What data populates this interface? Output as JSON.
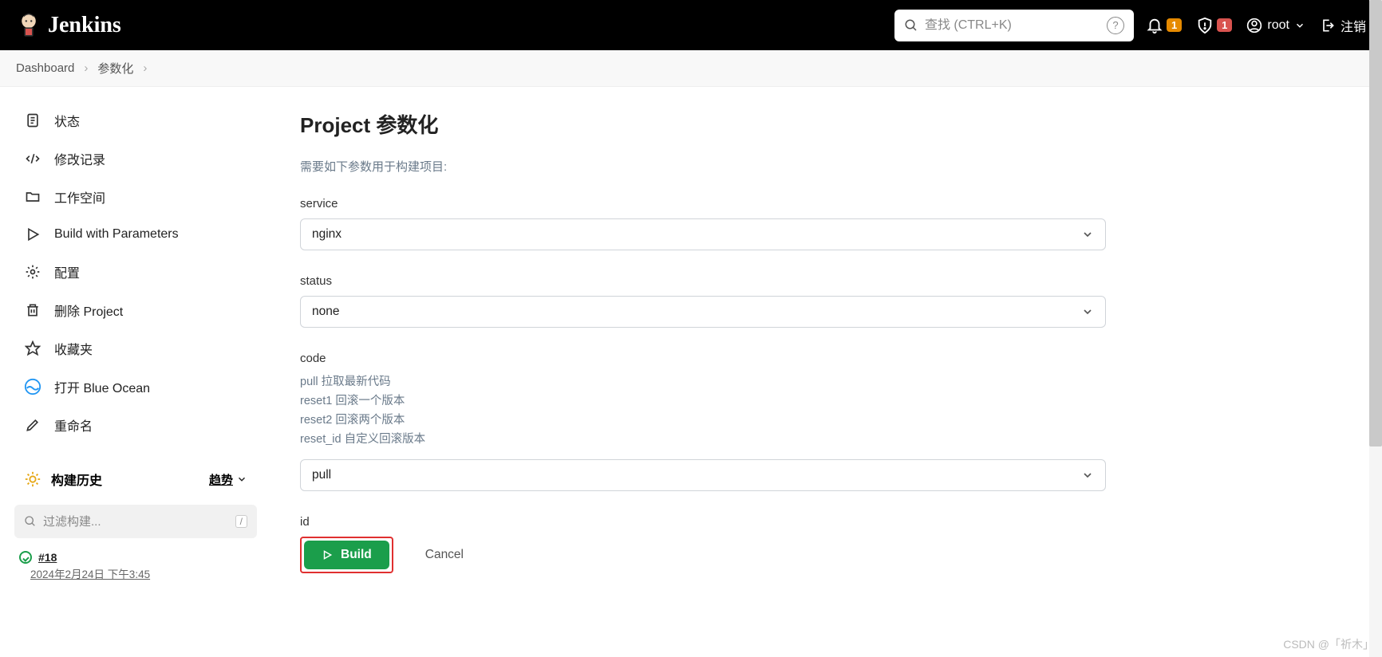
{
  "header": {
    "brand": "Jenkins",
    "search_placeholder": "查找 (CTRL+K)",
    "notif_count": "1",
    "alert_count": "1",
    "user": "root",
    "logout": "注销"
  },
  "breadcrumb": {
    "items": [
      "Dashboard",
      "参数化"
    ]
  },
  "sidebar": {
    "items": [
      {
        "label": "状态"
      },
      {
        "label": "修改记录"
      },
      {
        "label": "工作空间"
      },
      {
        "label": "Build with Parameters"
      },
      {
        "label": "配置"
      },
      {
        "label": "删除 Project"
      },
      {
        "label": "收藏夹"
      },
      {
        "label": "打开 Blue Ocean"
      },
      {
        "label": "重命名"
      }
    ],
    "build_history": {
      "title": "构建历史",
      "trend": "趋势",
      "filter_placeholder": "过滤构建...",
      "slash": "/",
      "builds": [
        {
          "num": "#18",
          "time": "2024年2月24日 下午3:45"
        }
      ]
    }
  },
  "main": {
    "title": "Project 参数化",
    "help": "需要如下参数用于构建项目:",
    "params": {
      "service": {
        "label": "service",
        "value": "nginx"
      },
      "status": {
        "label": "status",
        "value": "none"
      },
      "code": {
        "label": "code",
        "desc": [
          "pull 拉取最新代码",
          "reset1 回滚一个版本",
          "reset2 回滚两个版本",
          "reset_id 自定义回滚版本"
        ],
        "value": "pull"
      },
      "id": {
        "label": "id"
      }
    },
    "build_btn": "Build",
    "cancel_btn": "Cancel"
  },
  "watermark": "CSDN @「祈木」"
}
